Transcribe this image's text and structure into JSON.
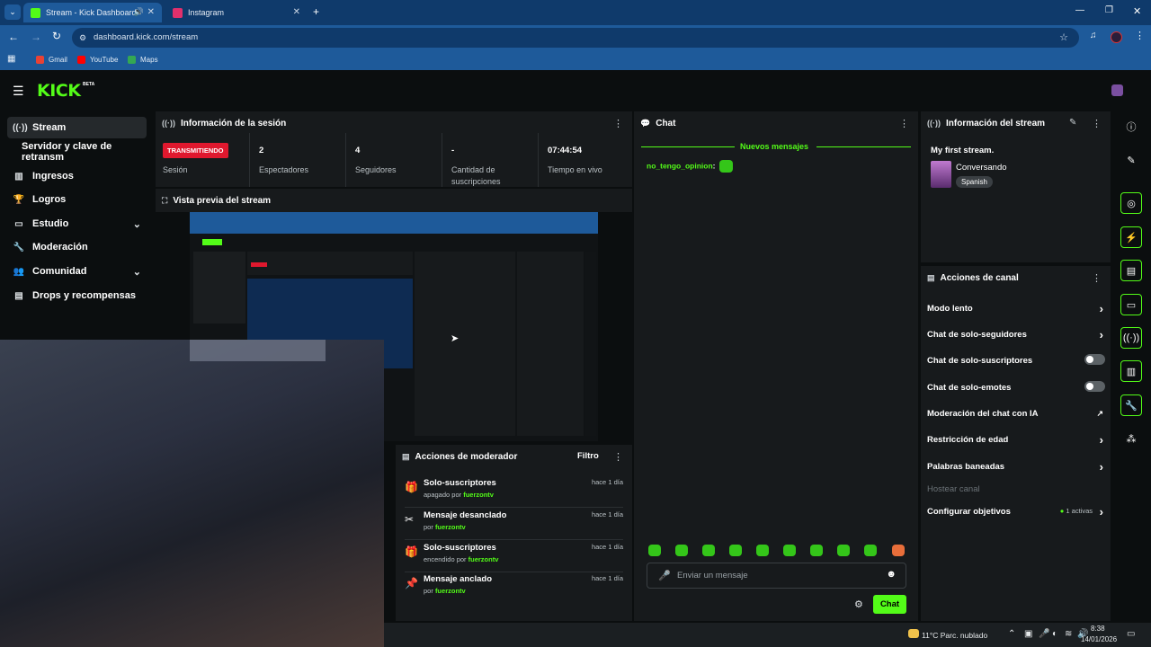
{
  "browser": {
    "tabs": [
      {
        "title": "Stream - Kick Dashboard",
        "active": true
      },
      {
        "title": "Instagram",
        "active": false
      }
    ],
    "url": "dashboard.kick.com/stream",
    "bookmarks": [
      "Gmail",
      "YouTube",
      "Maps"
    ]
  },
  "app": {
    "logo": "KICK",
    "logo_badge": "BETA"
  },
  "nav": {
    "items": [
      {
        "label": "Stream",
        "icon": "broadcast-icon"
      },
      {
        "label": "Servidor y clave de retransm",
        "icon": ""
      },
      {
        "label": "Ingresos",
        "icon": "chart-icon"
      },
      {
        "label": "Logros",
        "icon": "trophy-icon"
      },
      {
        "label": "Estudio",
        "icon": "studio-icon"
      },
      {
        "label": "Moderación",
        "icon": "wrench-icon"
      },
      {
        "label": "Comunidad",
        "icon": "people-icon"
      },
      {
        "label": "Drops y recompensas",
        "icon": "gift-icon"
      }
    ]
  },
  "session": {
    "title": "Información de la sesión",
    "status_badge": "TRANSMITIENDO",
    "stats": [
      {
        "value": "",
        "label": "Sesión"
      },
      {
        "value": "2",
        "label": "Espectadores"
      },
      {
        "value": "4",
        "label": "Seguidores"
      },
      {
        "value": "-",
        "label": "Cantidad de suscripciones"
      },
      {
        "value": "07:44:54",
        "label": "Tiempo en vivo"
      }
    ]
  },
  "preview": {
    "title": "Vista previa del stream"
  },
  "moderator_actions": {
    "title": "Acciones de moderador",
    "filter_label": "Filtro",
    "items": [
      {
        "title": "Solo-suscriptores",
        "sub_prefix": "apagado por",
        "user": "fuerzontv",
        "time": "hace 1 día"
      },
      {
        "title": "Mensaje desanclado",
        "sub_prefix": "por",
        "user": "fuerzontv",
        "time": "hace 1 día"
      },
      {
        "title": "Solo-suscriptores",
        "sub_prefix": "encendido por",
        "user": "fuerzontv",
        "time": "hace 1 día"
      },
      {
        "title": "Mensaje anclado",
        "sub_prefix": "por",
        "user": "fuerzontv",
        "time": "hace 1 día"
      }
    ]
  },
  "chat": {
    "title": "Chat",
    "new_messages": "Nuevos mensajes",
    "messages": [
      {
        "user": "no_tengo_opinion",
        "text": ":"
      }
    ],
    "input_placeholder": "Enviar un mensaje",
    "send_label": "Chat"
  },
  "stream_info": {
    "title": "Información del stream",
    "stream_title": "My first stream.",
    "category": "Conversando",
    "language": "Spanish"
  },
  "channel_actions": {
    "title": "Acciones de canal",
    "items": [
      {
        "label": "Modo lento",
        "control": "chevron"
      },
      {
        "label": "Chat de solo-seguidores",
        "control": "chevron"
      },
      {
        "label": "Chat de solo-suscriptores",
        "control": "toggle-off"
      },
      {
        "label": "Chat de solo-emotes",
        "control": "toggle-off"
      },
      {
        "label": "Moderación del chat con IA",
        "control": "external"
      },
      {
        "label": "Restricción de edad",
        "control": "chevron"
      },
      {
        "label": "Palabras baneadas",
        "control": "chevron"
      },
      {
        "label": "Hostear canal",
        "control": "disabled"
      },
      {
        "label": "Configurar objetivos",
        "control": "chevron",
        "status": "1 activas"
      }
    ]
  },
  "taskbar": {
    "weather": "11°C  Parc. nublado",
    "time": "8:38",
    "date": "14/01/2026"
  },
  "colors": {
    "accent": "#53fc18",
    "live": "#e0182e",
    "panel": "#171a1c",
    "background": "#0b0e0f"
  }
}
